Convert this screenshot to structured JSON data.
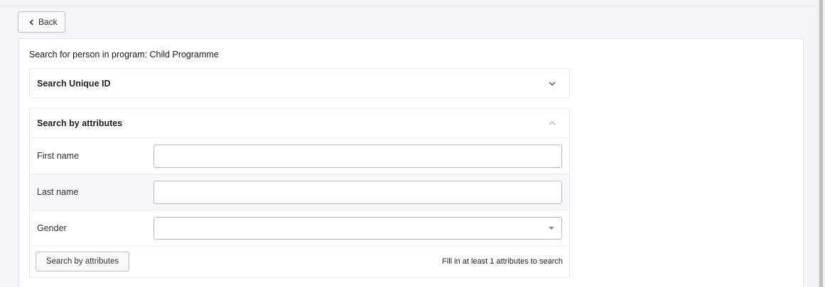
{
  "back_button": {
    "label": "Back",
    "icon": "chevron-left-icon"
  },
  "page": {
    "title": "Search for person in program: Child Programme"
  },
  "sections": {
    "unique_id": {
      "title": "Search Unique ID",
      "icon": "chevron-down-icon",
      "expanded": false
    },
    "attributes": {
      "title": "Search by attributes",
      "icon": "chevron-up-icon",
      "expanded": true,
      "fields": [
        {
          "label": "First name",
          "value": "",
          "type": "text"
        },
        {
          "label": "Last name",
          "value": "",
          "type": "text"
        },
        {
          "label": "Gender",
          "value": "",
          "type": "select"
        }
      ],
      "search_button_label": "Search by attributes",
      "hint": "Fill in at least 1 attributes to search"
    }
  },
  "colors": {
    "background": "#f4f5f6",
    "card": "#ffffff",
    "border": "#b7bcc1",
    "alt_row": "#f6f7f8"
  }
}
